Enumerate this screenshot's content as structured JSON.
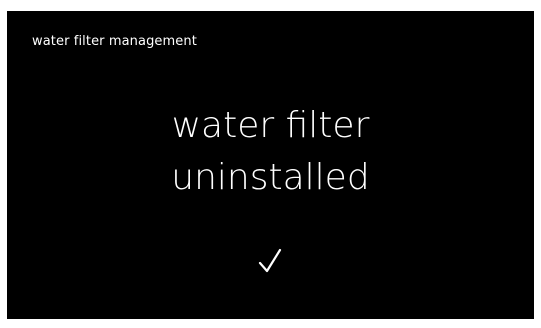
{
  "screen": {
    "header_title": "water filter management",
    "message": {
      "line1": "water filter",
      "line2": "uninstalled"
    },
    "confirm_icon": "checkmark-icon",
    "colors": {
      "background": "#000000",
      "text": "#ffffff"
    }
  }
}
